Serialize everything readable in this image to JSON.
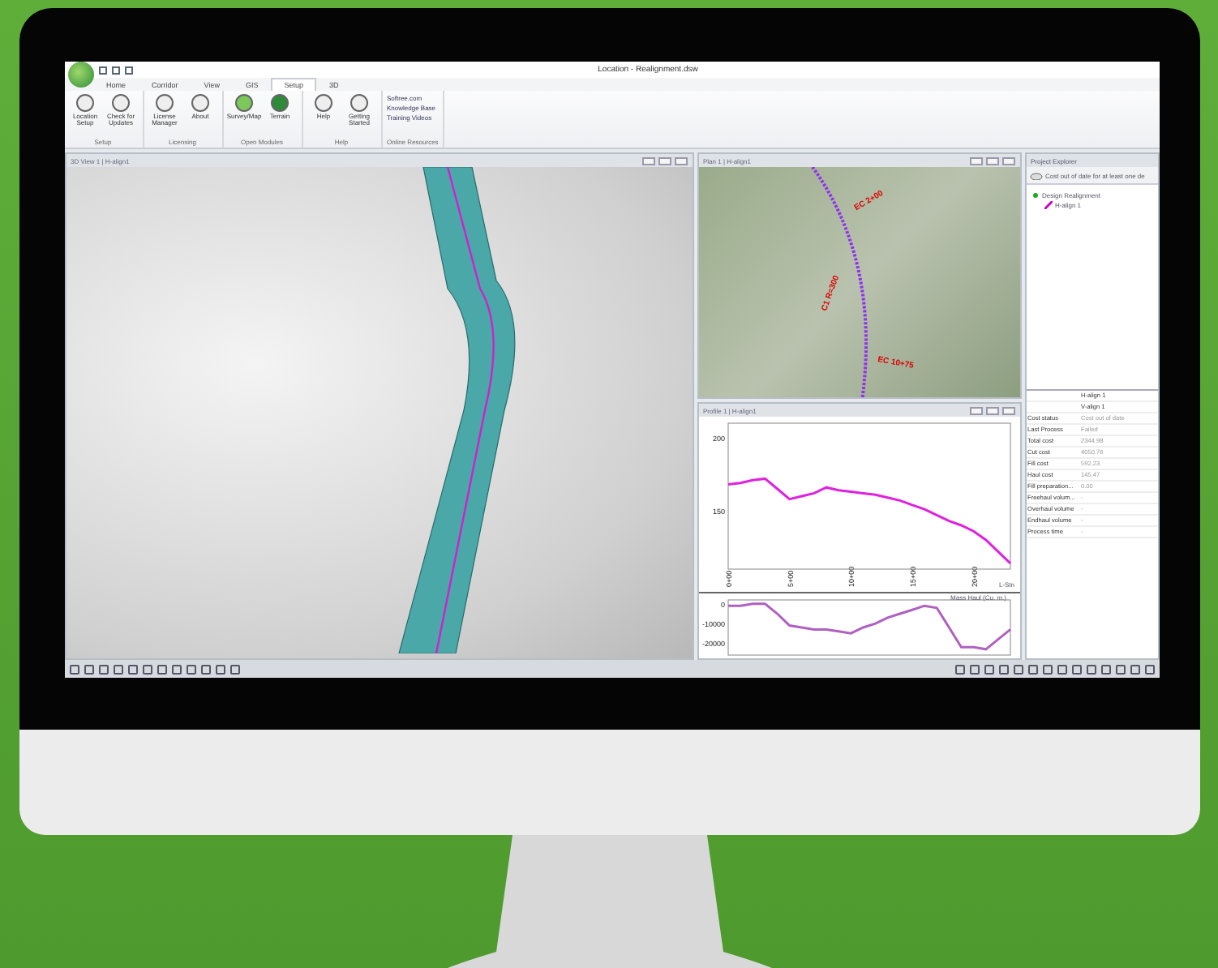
{
  "window": {
    "title": "Location - Realignment.dsw"
  },
  "tabs": [
    {
      "label": "Home",
      "selected": false
    },
    {
      "label": "Corridor",
      "selected": false
    },
    {
      "label": "View",
      "selected": false
    },
    {
      "label": "GIS",
      "selected": false
    },
    {
      "label": "Setup",
      "selected": true
    },
    {
      "label": "3D",
      "selected": false
    }
  ],
  "ribbon_groups": [
    {
      "name": "Setup",
      "buttons": [
        "Location Setup",
        "Check for Updates"
      ]
    },
    {
      "name": "Licensing",
      "buttons": [
        "License Manager",
        "About"
      ]
    },
    {
      "name": "Open Modules",
      "buttons": [
        "Survey/Map",
        "Terrain"
      ]
    },
    {
      "name": "Help",
      "buttons": [
        "Help",
        "Getting Started"
      ]
    },
    {
      "name": "Online Resources",
      "links": [
        "Softree.com",
        "Knowledge Base",
        "Training Videos"
      ]
    }
  ],
  "views": {
    "three_d": {
      "title": "3D View 1 | H-align1"
    },
    "plan": {
      "title": "Plan 1 | H-align1",
      "labels": [
        "EC 2+00",
        "C1 R=300",
        "EC 10+75"
      ]
    },
    "profile": {
      "title": "Profile 1 | H-align1",
      "chart_data": {
        "type": "line",
        "xlabel": "L-Stn",
        "categories": [
          "0+00",
          null,
          null,
          null,
          null,
          "5+00",
          null,
          null,
          null,
          null,
          "10+00",
          null,
          null,
          null,
          null,
          "15+00",
          null,
          null,
          null,
          null,
          "20+00",
          null,
          null,
          null
        ],
        "yticks": [
          150,
          200
        ],
        "ylim": [
          110,
          210
        ],
        "series": [
          {
            "color": "#e020e0",
            "values": [
              168,
              169,
              171,
              172,
              165,
              158,
              160,
              162,
              166,
              164,
              163,
              162,
              161,
              159,
              157,
              154,
              151,
              147,
              143,
              140,
              136,
              130,
              122,
              114
            ]
          }
        ]
      },
      "mass_haul": {
        "chart_data": {
          "type": "line",
          "title": "Mass Haul (Cu. m.)",
          "categories": [
            null,
            null,
            null,
            null,
            null,
            null,
            null,
            null,
            null,
            null,
            null,
            null,
            null,
            null,
            null,
            null,
            null,
            null,
            null,
            null,
            null,
            null,
            null,
            null
          ],
          "yticks": [
            0,
            -10000,
            -20000
          ],
          "ylim": [
            -26000,
            2000
          ],
          "series": [
            {
              "color": "#b060c0",
              "values": [
                -1000,
                -1000,
                0,
                0,
                -5000,
                -11000,
                -12000,
                -13000,
                -13000,
                -14000,
                -15000,
                -12000,
                -10000,
                -7000,
                -5000,
                -3000,
                -1000,
                -2000,
                -12000,
                -22000,
                -22000,
                -23000,
                -18000,
                -13000
              ]
            }
          ]
        }
      }
    }
  },
  "explorer": {
    "title": "Project Explorer",
    "message": "Cost out of date for at least one de",
    "tree": [
      {
        "label": "Design Realignment",
        "children": [
          {
            "label": "H-align 1"
          }
        ]
      }
    ],
    "columns": [
      "H-align 1",
      "V-align 1"
    ],
    "properties": [
      {
        "name": "Cost status",
        "value": "Cost out of date"
      },
      {
        "name": "Last Process",
        "value": "Failed"
      },
      {
        "name": "Total cost",
        "value": "2344.98"
      },
      {
        "name": "Cut cost",
        "value": "4050.76"
      },
      {
        "name": "Fill cost",
        "value": "592.23"
      },
      {
        "name": "Haul cost",
        "value": "145.47"
      },
      {
        "name": "Fill preparation...",
        "value": "0.00"
      },
      {
        "name": "Freehaul volum...",
        "value": "-"
      },
      {
        "name": "Overhaul volume",
        "value": "-"
      },
      {
        "name": "Endhaul volume",
        "value": "-"
      },
      {
        "name": "Process time",
        "value": "-"
      }
    ]
  }
}
